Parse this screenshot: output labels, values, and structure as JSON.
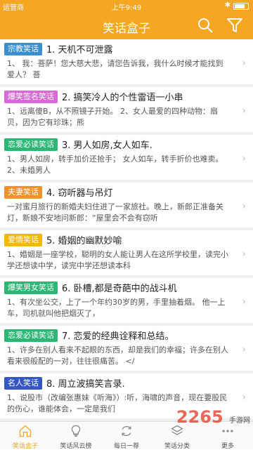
{
  "status": {
    "carrier": "运营商",
    "time": "上午9:49"
  },
  "header": {
    "title": "笑话盒子"
  },
  "items": [
    {
      "tag": "宗教笑话",
      "tag_color": "#3a8fd1",
      "title": "1. 天机不可泄露",
      "excerpt": "1、 我：菩萨！您大慈大悲，请您告诉我，我什么时候才能找到爱人？ 菩"
    },
    {
      "tag": "爆笑签名笑话",
      "tag_color": "#d86ad6",
      "title": "2. 搞笑冷人的个性雷语一小串",
      "excerpt": "1、远离傻B，从不照镜子开始。 2、女人最爱的四种动物：扇贝，因为它有珍珠；熊"
    },
    {
      "tag": "恋爱必读笑话",
      "tag_color": "#2bb673",
      "title": "3. 男人如房,女人如车.",
      "excerpt": "1、男人如房，转手加价还抢手； 女人如车，转手折价也难卖。 2、未婚男人"
    },
    {
      "tag": "夫妻笑话",
      "tag_color": "#f0922b",
      "title": "4. 窃听器与吊灯",
      "excerpt": "一对蜜月旅行的新婚夫妇住进了一家旅社。晚上，新郎正准备关灯，新娘不安地问新郎：“屋里会不会有窃听"
    },
    {
      "tag": "爱情笑话",
      "tag_color": "#f5b800",
      "title": "5. 婚姻的幽默妙喻",
      "excerpt": "1、婚姻是一座学校，聪明的女人能让男人在这所学校里，读完小学还想读中学，读完中学还想读本科"
    },
    {
      "tag": "爆笑男女笑话",
      "tag_color": "#2bb673",
      "title": "6. 卧槽,都是奇葩中的战斗机",
      "excerpt": "1、有次坐公交，上了一个年约30岁的男，手里抽着烟。 他一上车，司机就叫他把烟灭了，"
    },
    {
      "tag": "恋爱必读笑话",
      "tag_color": "#2bb673",
      "title": "7. 恋爱的经典诠释和总结。",
      "excerpt": "1、许多在别人看来不起眼的东西，却是我们的幸福；许多在别人看来很般配的一对，往往很痛苦。 </"
    },
    {
      "tag": "名人笑话",
      "tag_color": "#3557c5",
      "title": "8. 周立波搞笑言录.",
      "excerpt": "1、说股市（改编张惠妹《听海》）:听，海啸的声音，现在要股民的伤心，谁能体会，一定是我们"
    }
  ],
  "tabs": [
    {
      "label": "笑话盒子",
      "icon": "home-icon",
      "active": true
    },
    {
      "label": "笑话风云榜",
      "icon": "bulb-icon",
      "active": false
    },
    {
      "label": "每日一荐",
      "icon": "refresh-icon",
      "active": false
    },
    {
      "label": "笑话分类",
      "icon": "category-icon",
      "active": false
    },
    {
      "label": "更多",
      "icon": "more-icon",
      "active": false
    }
  ],
  "watermark": {
    "brand": "2265",
    "sub": "手游网"
  }
}
